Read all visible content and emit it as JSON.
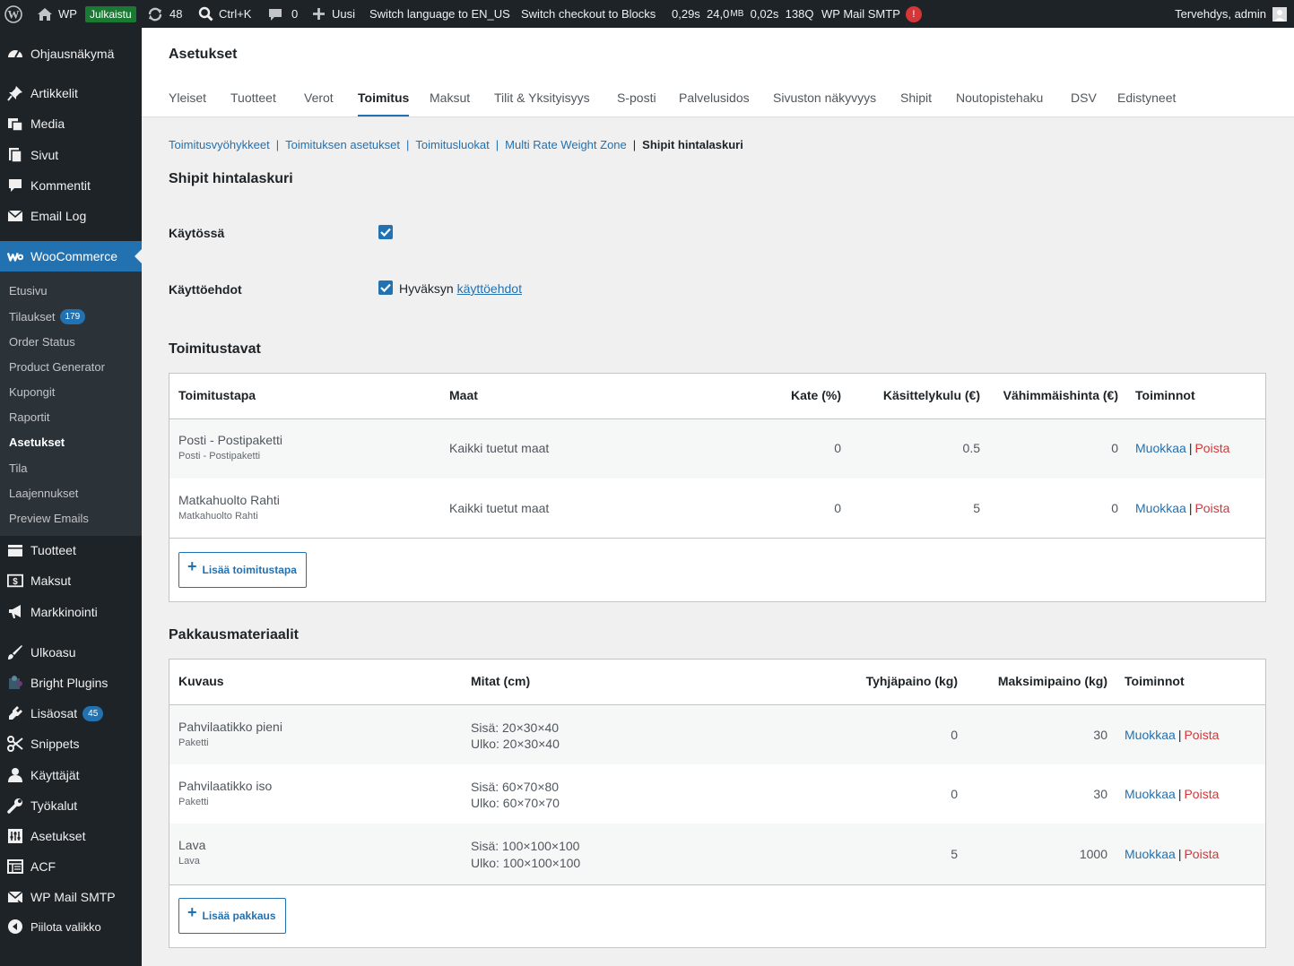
{
  "adminbar": {
    "site_name": "WP",
    "status_badge": "Julkaistu",
    "updates_count": "48",
    "search_shortcut": "Ctrl+K",
    "comments_count": "0",
    "new_label": "Uusi",
    "switch_language": "Switch language to EN_US",
    "switch_checkout": "Switch checkout to Blocks",
    "perf_time": "0,29s",
    "perf_mem": "24,0",
    "perf_mem_unit": "MB",
    "perf_query_time": "0,02s",
    "perf_queries": "138Q",
    "wp_mail_smtp": "WP Mail SMTP",
    "smtp_alert": "!",
    "greeting": "Tervehdys, admin"
  },
  "sidebar": {
    "items": [
      {
        "label": "Ohjausnäkymä",
        "icon": "dashboard-icon"
      },
      {
        "label": "Artikkelit",
        "icon": "pin-icon"
      },
      {
        "label": "Media",
        "icon": "media-icon"
      },
      {
        "label": "Sivut",
        "icon": "pages-icon"
      },
      {
        "label": "Kommentit",
        "icon": "comment-icon"
      },
      {
        "label": "Email Log",
        "icon": "email-icon"
      },
      {
        "label": "WooCommerce",
        "icon": "woocommerce-icon"
      },
      {
        "label": "Tuotteet",
        "icon": "products-icon"
      },
      {
        "label": "Maksut",
        "icon": "payments-icon"
      },
      {
        "label": "Markkinointi",
        "icon": "megaphone-icon"
      },
      {
        "label": "Ulkoasu",
        "icon": "brush-icon"
      },
      {
        "label": "Bright Plugins",
        "icon": "puzzle-icon"
      },
      {
        "label": "Lisäosat",
        "icon": "plugin-icon",
        "count": "45"
      },
      {
        "label": "Snippets",
        "icon": "scissors-icon"
      },
      {
        "label": "Käyttäjät",
        "icon": "user-icon"
      },
      {
        "label": "Työkalut",
        "icon": "wrench-icon"
      },
      {
        "label": "Asetukset",
        "icon": "settings-icon"
      },
      {
        "label": "ACF",
        "icon": "acf-icon"
      },
      {
        "label": "WP Mail SMTP",
        "icon": "mail-icon"
      },
      {
        "label": "Piilota valikko",
        "icon": "collapse-icon"
      }
    ],
    "woo_submenu": [
      {
        "label": "Etusivu"
      },
      {
        "label": "Tilaukset",
        "count": "179"
      },
      {
        "label": "Order Status"
      },
      {
        "label": "Product Generator"
      },
      {
        "label": "Kupongit"
      },
      {
        "label": "Raportit"
      },
      {
        "label": "Asetukset"
      },
      {
        "label": "Tila"
      },
      {
        "label": "Laajennukset"
      },
      {
        "label": "Preview Emails"
      }
    ]
  },
  "header": {
    "title": "Asetukset",
    "tabs": [
      "Yleiset",
      "Tuotteet",
      "Verot",
      "Toimitus",
      "Maksut",
      "Tilit & Yksityisyys",
      "S-posti",
      "Palvelusidos",
      "Sivuston näkyvyys",
      "Shipit",
      "Noutopistehaku",
      "DSV",
      "Edistyneet"
    ],
    "active_tab": "Toimitus"
  },
  "subsubsub": {
    "links": [
      "Toimitusvyöhykkeet",
      "Toimituksen asetukset",
      "Toimitusluokat",
      "Multi Rate Weight Zone"
    ],
    "current": "Shipit hintalaskuri"
  },
  "main": {
    "section_title": "Shipit hintalaskuri",
    "enabled_label": "Käytössä",
    "enabled": true,
    "terms_label": "Käyttöehdot",
    "terms_text": "Hyväksyn",
    "terms_link": "käyttöehdot",
    "terms_accepted": true
  },
  "shipping": {
    "title": "Toimitustavat",
    "headers": {
      "method": "Toimitustapa",
      "countries": "Maat",
      "margin": "Kate (%)",
      "handling": "Käsittelykulu (€)",
      "min_price": "Vähimmäishinta (€)",
      "actions": "Toiminnot"
    },
    "rows": [
      {
        "name": "Posti - Postipaketti",
        "sub": "Posti - Postipaketti",
        "countries": "Kaikki tuetut maat",
        "margin": "0",
        "handling": "0.5",
        "min_price": "0"
      },
      {
        "name": "Matkahuolto Rahti",
        "sub": "Matkahuolto Rahti",
        "countries": "Kaikki tuetut maat",
        "margin": "0",
        "handling": "5",
        "min_price": "0"
      }
    ],
    "edit_label": "Muokkaa",
    "delete_label": "Poista",
    "add_label": "Lisää toimitustapa"
  },
  "packaging": {
    "title": "Pakkausmateriaalit",
    "headers": {
      "description": "Kuvaus",
      "dimensions": "Mitat (cm)",
      "empty_weight": "Tyhjäpaino (kg)",
      "max_weight": "Maksimipaino (kg)",
      "actions": "Toiminnot"
    },
    "rows": [
      {
        "name": "Pahvilaatikko pieni",
        "sub": "Paketti",
        "inner": "Sisä: 20×30×40",
        "outer": "Ulko: 20×30×40",
        "empty_weight": "0",
        "max_weight": "30"
      },
      {
        "name": "Pahvilaatikko iso",
        "sub": "Paketti",
        "inner": "Sisä: 60×70×80",
        "outer": "Ulko: 60×70×70",
        "empty_weight": "0",
        "max_weight": "30"
      },
      {
        "name": "Lava",
        "sub": "Lava",
        "inner": "Sisä: 100×100×100",
        "outer": "Ulko: 100×100×100",
        "empty_weight": "5",
        "max_weight": "1000"
      }
    ],
    "edit_label": "Muokkaa",
    "delete_label": "Poista",
    "add_label": "Lisää pakkaus"
  },
  "colors": {
    "accent": "#2271b1",
    "danger": "#d63638",
    "sidebar": "#1d2327",
    "published": "#1a7a34"
  }
}
